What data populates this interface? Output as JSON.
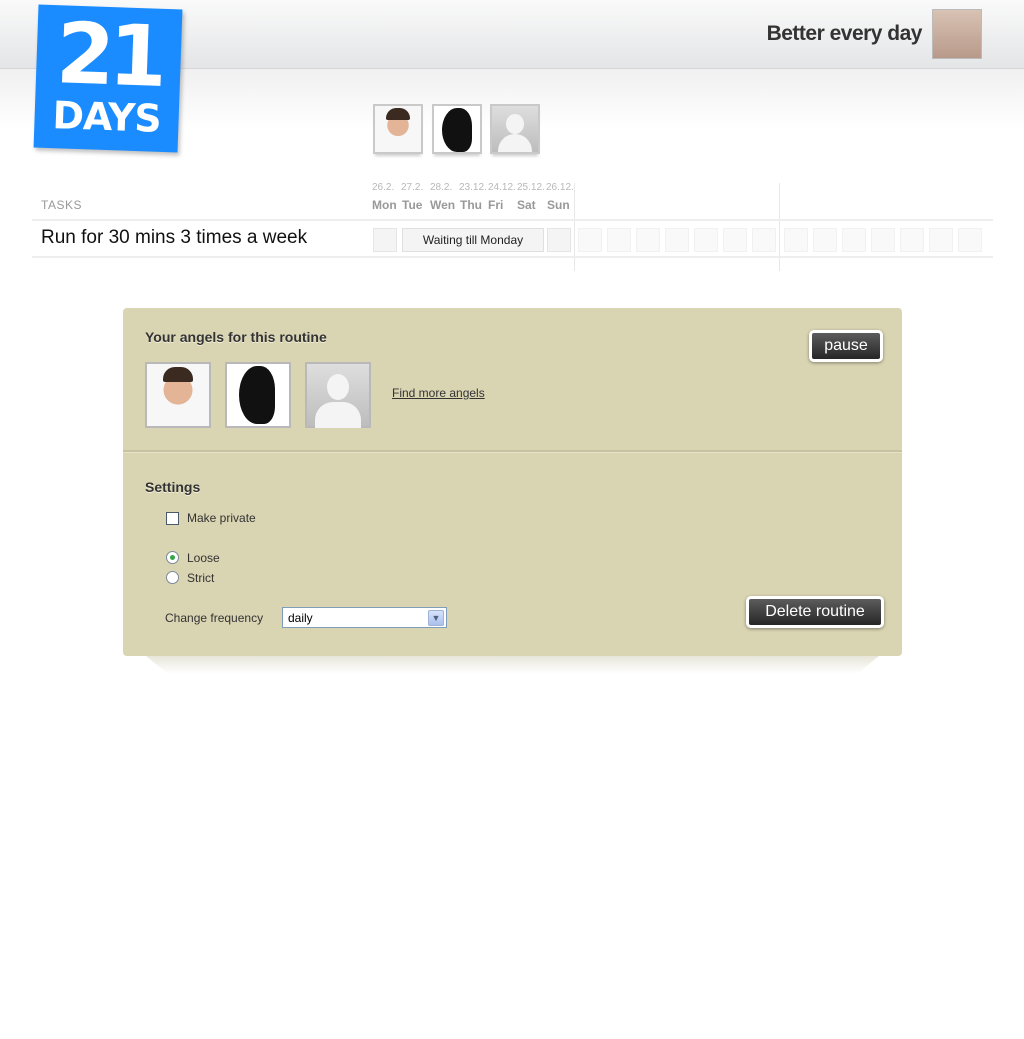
{
  "header": {
    "logo_number": "21",
    "logo_word": "DAYS",
    "tagline": "Better every day"
  },
  "timeline": {
    "tasks_label": "TASKS",
    "dates": [
      "26.2.",
      "27.2.",
      "28.2.",
      "23.12.",
      "24.12.",
      "25.12.",
      "26.12."
    ],
    "days": [
      "Mon",
      "Tue",
      "Wen",
      "Thu",
      "Fri",
      "Sat",
      "Sun"
    ]
  },
  "task": {
    "name": "Run for 30 mins 3 times a week",
    "status": "Waiting till Monday"
  },
  "angels_section": {
    "title": "Your angels for this routine",
    "find_more": "Find more angels",
    "pause_label": "pause"
  },
  "settings": {
    "title": "Settings",
    "make_private_label": "Make private",
    "make_private_checked": false,
    "loose_label": "Loose",
    "strict_label": "Strict",
    "selected_mode": "Loose",
    "frequency_label": "Change frequency",
    "frequency_value": "daily",
    "delete_label": "Delete routine"
  },
  "colors": {
    "logo_blue": "#1a8cff",
    "panel_bg": "#d9d4b2"
  }
}
